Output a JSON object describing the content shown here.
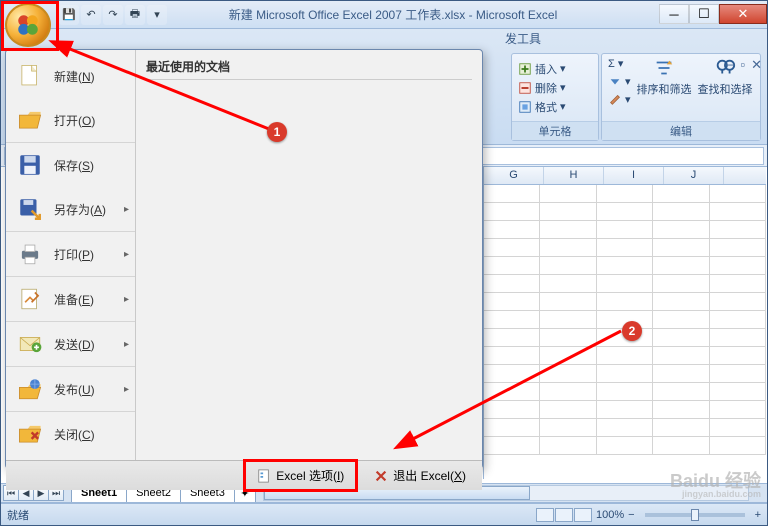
{
  "title": "新建 Microsoft Office Excel 2007 工作表.xlsx - Microsoft Excel",
  "ribbon": {
    "visible_tab": "发工具",
    "cells_group": {
      "label": "单元格",
      "insert": "插入",
      "delete": "删除",
      "format": "格式"
    },
    "editing_group": {
      "label": "编辑",
      "sum": "Σ",
      "sort": "排序和筛选",
      "find": "查找和选择"
    }
  },
  "office_menu": {
    "recent_title": "最近使用的文档",
    "items": [
      {
        "label": "新建(N)",
        "shortcut": "N",
        "arrow": false
      },
      {
        "label": "打开(O)",
        "shortcut": "O",
        "arrow": false
      },
      {
        "label": "保存(S)",
        "shortcut": "S",
        "arrow": false
      },
      {
        "label": "另存为(A)",
        "shortcut": "A",
        "arrow": true
      },
      {
        "label": "打印(P)",
        "shortcut": "P",
        "arrow": true
      },
      {
        "label": "准备(E)",
        "shortcut": "E",
        "arrow": true
      },
      {
        "label": "发送(D)",
        "shortcut": "D",
        "arrow": true
      },
      {
        "label": "发布(U)",
        "shortcut": "U",
        "arrow": true
      },
      {
        "label": "关闭(C)",
        "shortcut": "C",
        "arrow": false
      }
    ],
    "footer": {
      "options": "Excel 选项(I)",
      "exit": "退出 Excel(X)"
    }
  },
  "sheets": [
    "Sheet1",
    "Sheet2",
    "Sheet3"
  ],
  "columns": [
    "G",
    "H",
    "I",
    "J"
  ],
  "status": {
    "ready": "就绪",
    "zoom": "100%"
  },
  "annotations": {
    "c1": "1",
    "c2": "2"
  },
  "watermark": {
    "brand": "Baidu 经验",
    "url": "jingyan.baidu.com"
  }
}
